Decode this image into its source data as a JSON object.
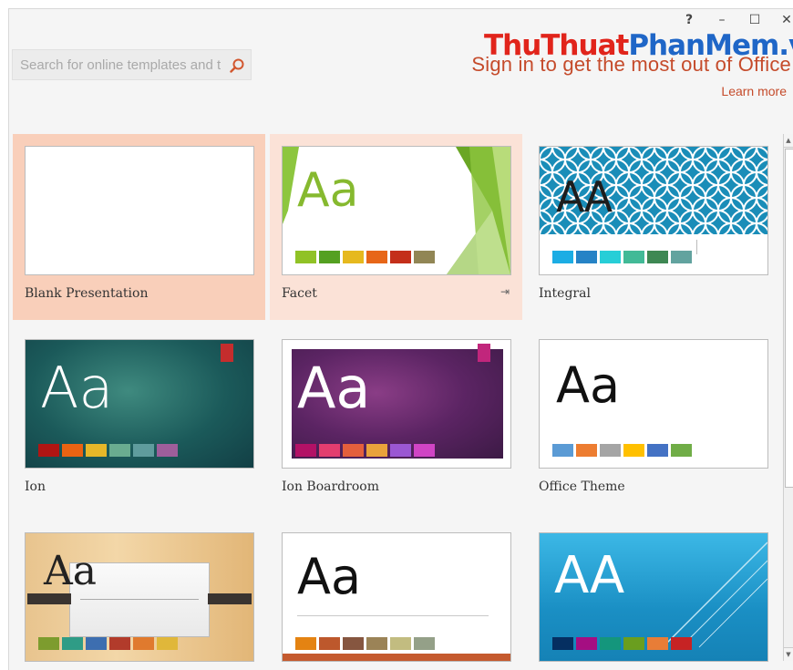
{
  "window": {
    "help_label": "?",
    "minimize_label": "–",
    "maximize_label": "☐",
    "close_label": "✕"
  },
  "search": {
    "placeholder": "Search for online templates and themes",
    "icon": "search-icon"
  },
  "signin": {
    "text": "Sign in to get the most out of Office",
    "learn_more": "Learn more"
  },
  "watermark": {
    "part1": "ThuThuat",
    "part2": "PhanMem",
    "part3": ".vn"
  },
  "templates": [
    {
      "name": "Blank Presentation",
      "sample": ""
    },
    {
      "name": "Facet",
      "sample": "Aa",
      "pin": "⇥"
    },
    {
      "name": "Integral",
      "sample": "AA"
    },
    {
      "name": "Ion",
      "sample": "Aa"
    },
    {
      "name": "Ion Boardroom",
      "sample": "Aa"
    },
    {
      "name": "Office Theme",
      "sample": "Aa"
    },
    {
      "name": "",
      "sample": "Aa"
    },
    {
      "name": "",
      "sample": "Aa"
    },
    {
      "name": "",
      "sample": "AA"
    }
  ],
  "colors": {
    "accent": "#c54b2b",
    "highlight": "#f9cfba"
  }
}
